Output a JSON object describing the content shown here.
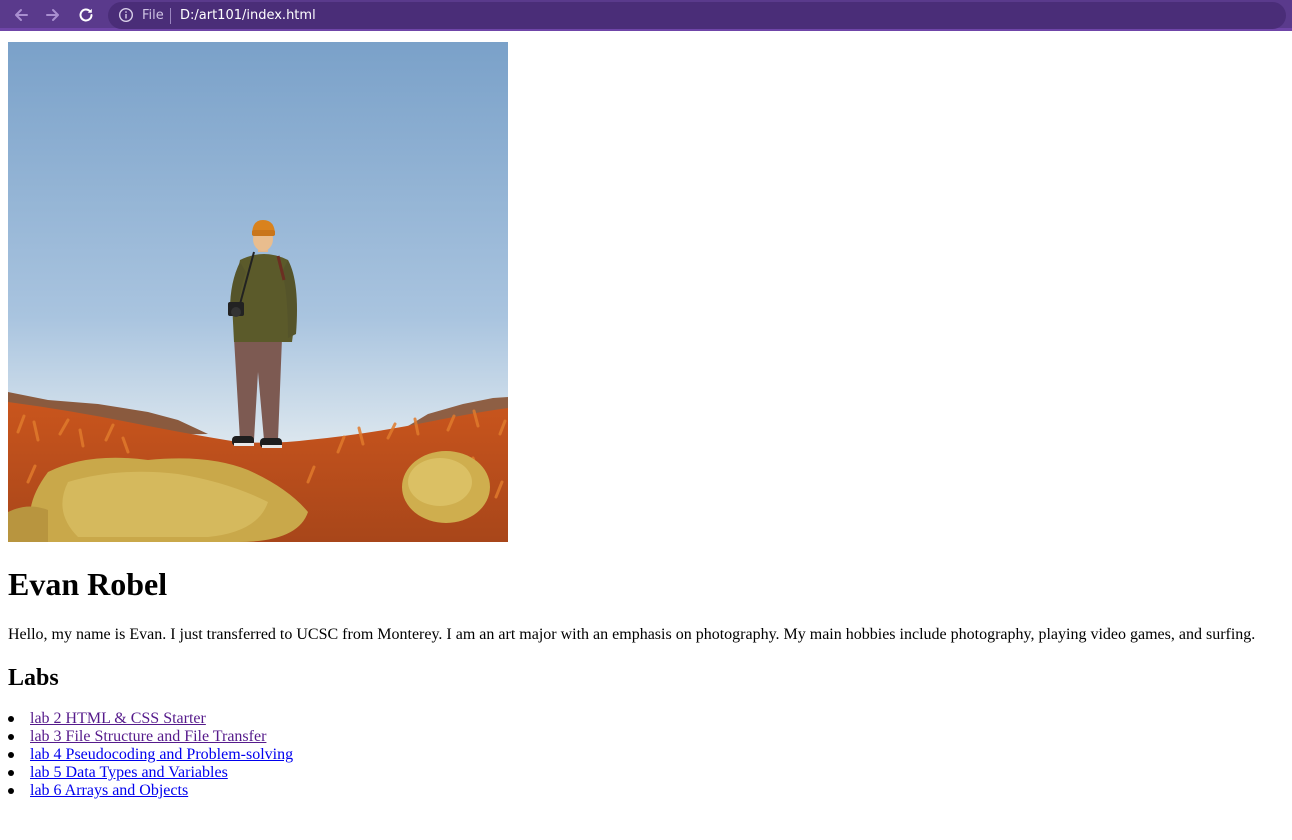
{
  "browser": {
    "scheme_label": "File",
    "url": "D:/art101/index.html",
    "colors": {
      "toolbar": "#5a3a8c",
      "omnibox": "#4a2d78"
    }
  },
  "icons": {
    "back": "arrow-left-icon",
    "forward": "arrow-right-icon",
    "reload": "reload-icon",
    "info": "info-circle-icon"
  },
  "page": {
    "photo": {
      "subject": "profile-photo"
    },
    "title": "Evan Robel",
    "intro": "Hello, my name is Evan. I just transferred to UCSC from Monterey. I am an art major with an emphasis on photography. My main hobbies include photography, playing video games, and surfing.",
    "labs_heading": "Labs",
    "labs": [
      {
        "label": "lab 2 HTML & CSS Starter",
        "visited": true
      },
      {
        "label": "lab 3 File Structure and File Transfer",
        "visited": true
      },
      {
        "label": "lab 4 Pseudocoding and Problem-solving",
        "visited": false
      },
      {
        "label": "lab 5 Data Types and Variables",
        "visited": false
      },
      {
        "label": "lab 6 Arrays and Objects",
        "visited": false
      }
    ],
    "link_colors": {
      "visited": "#551a8b",
      "unvisited": "#0000ee"
    }
  }
}
